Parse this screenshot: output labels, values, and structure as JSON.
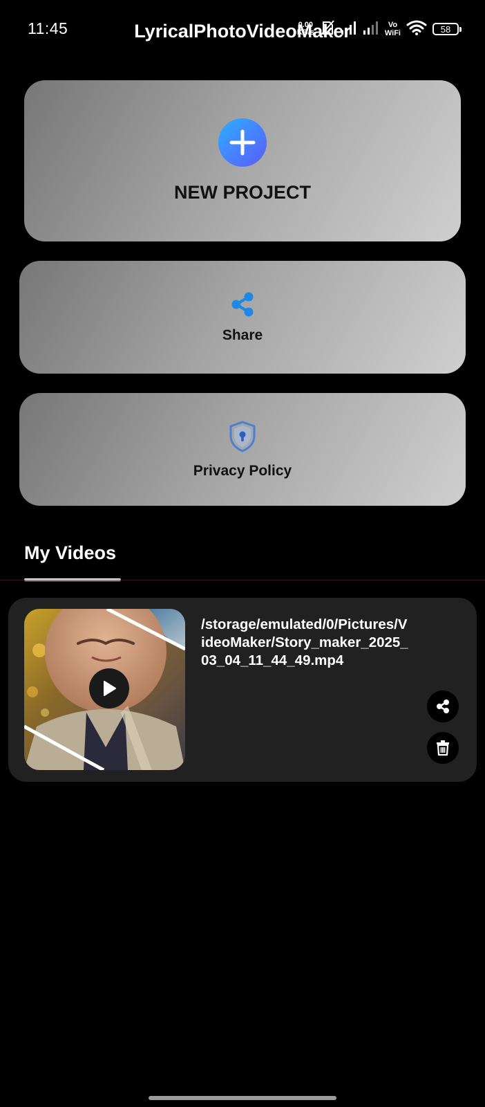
{
  "status_bar": {
    "time": "11:45",
    "net_speed_value": "0.00",
    "net_speed_unit": "KB/s",
    "vowifi_top": "Vo",
    "vowifi_bottom": "WiFi",
    "battery": "58"
  },
  "app": {
    "title": "LyricalPhotoVideoMaker"
  },
  "actions": {
    "new_project_label": "NEW PROJECT",
    "share_label": "Share",
    "privacy_label": "Privacy Policy"
  },
  "tabs": {
    "active_label": "My Videos"
  },
  "videos": {
    "items": [
      {
        "path": "/storage/emulated/0/Pictures/VideoMaker/Story_maker_2025_03_04_11_44_49.mp4"
      }
    ]
  },
  "colors": {
    "accent_blue": "#1e88e5",
    "card_gradient_start": "#777777",
    "card_gradient_end": "#cfcfcf",
    "plus_gradient_start": "#2bb0ff",
    "plus_gradient_end": "#5c5cf0"
  },
  "icons": {
    "new_project": "plus-icon",
    "share": "share-icon",
    "privacy": "shield-lock-icon",
    "play": "play-icon",
    "item_share": "share-icon",
    "item_delete": "trash-icon"
  }
}
